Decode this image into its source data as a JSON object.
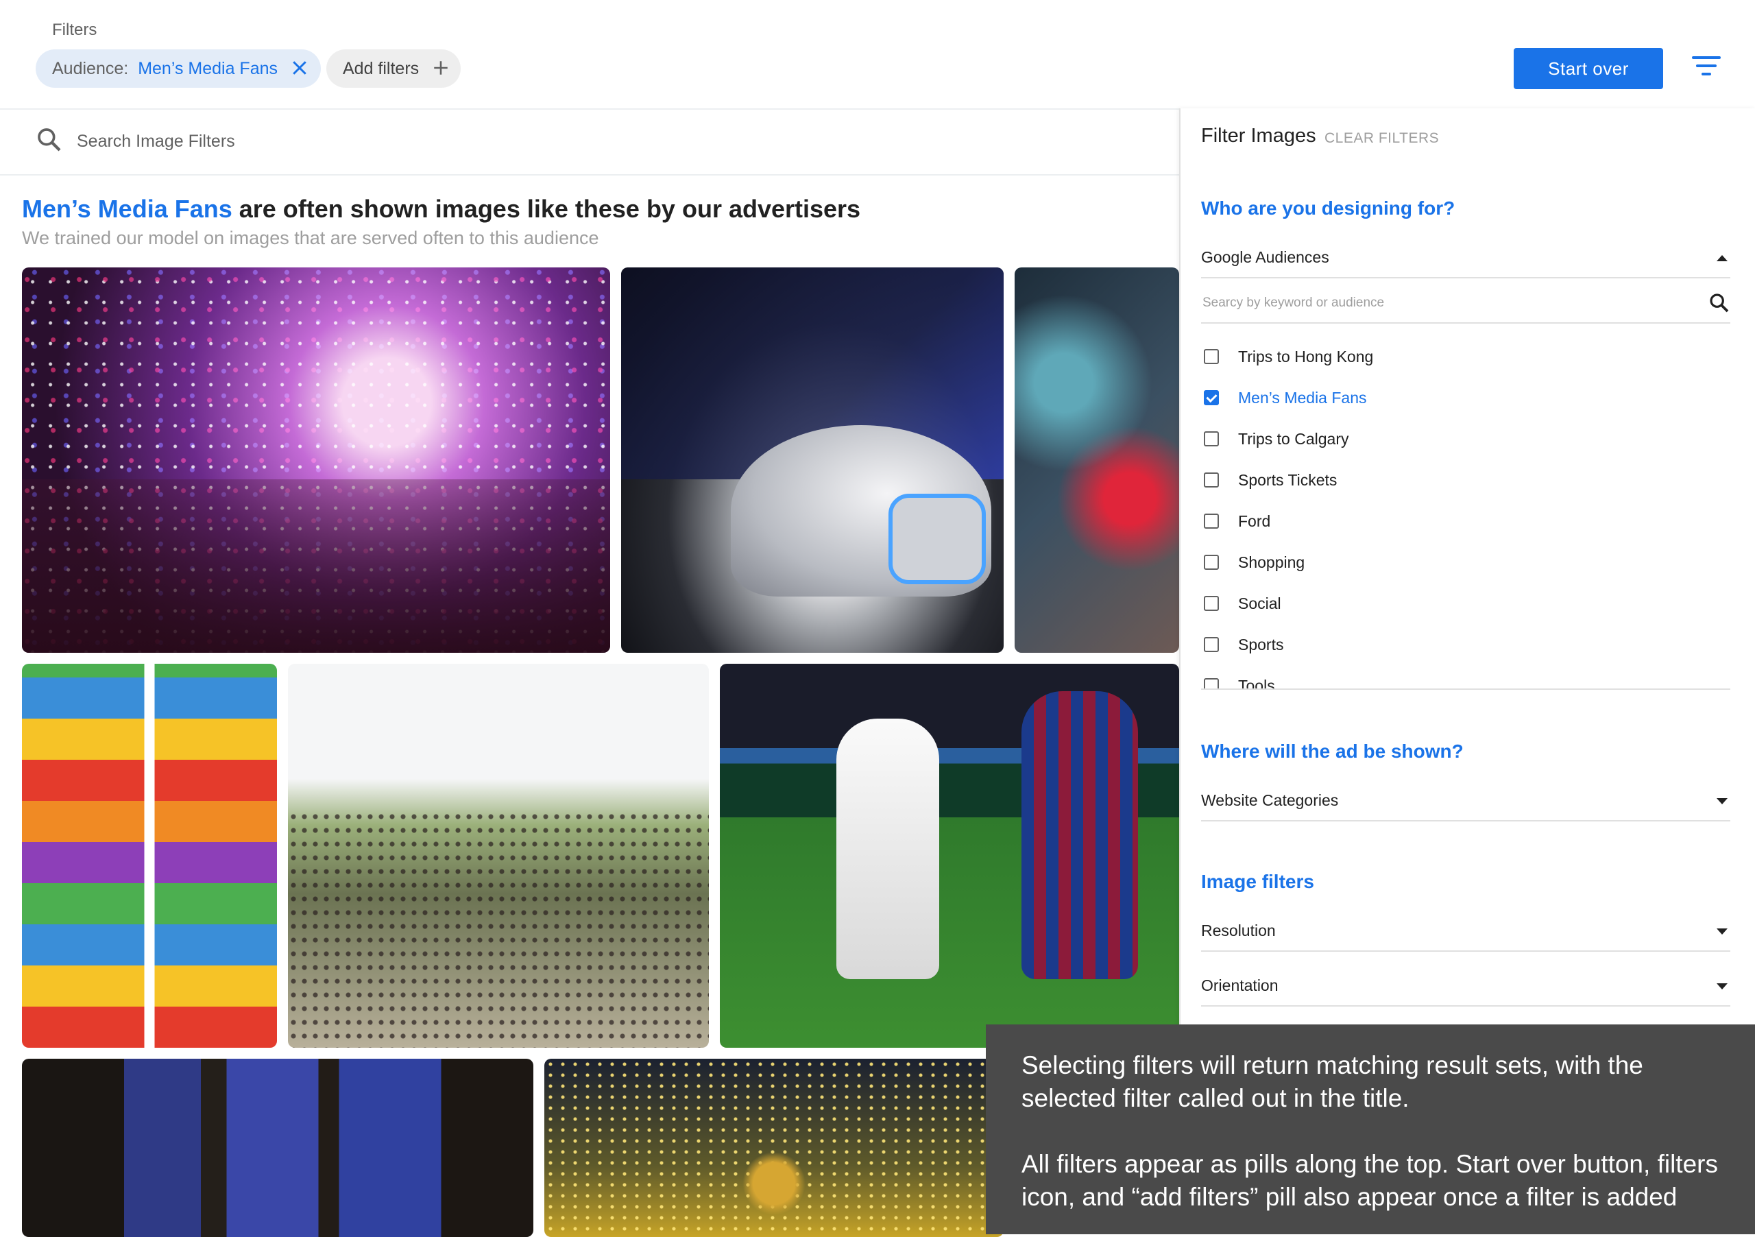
{
  "topbar": {
    "filters_label": "Filters",
    "audience_pill": {
      "key": "Audience:",
      "value": "Men’s Media Fans"
    },
    "add_filters_label": "Add filters",
    "start_over_label": "Start over"
  },
  "search": {
    "placeholder": "Search Image Filters",
    "value": ""
  },
  "results": {
    "title_highlight": "Men’s Media Fans",
    "title_rest": " are often shown images like these by our advertisers",
    "subtitle": "We trained our model on images that are served often to this audience",
    "images": [
      "confetti-crowd",
      "concept-car",
      "blurred-closeup",
      "comic-collage",
      "festival-crowd",
      "soccer-match",
      "esports-gaming",
      "trophy-celebration"
    ]
  },
  "panel": {
    "title": "Filter Images",
    "clear_label": "CLEAR FILTERS",
    "section_who": "Who are you designing for?",
    "audiences_dropdown": "Google Audiences",
    "audience_search_placeholder": "Searcy by keyword or audience",
    "audience_options": [
      {
        "label": "Trips to Hong Kong",
        "checked": false
      },
      {
        "label": "Men’s Media Fans",
        "checked": true
      },
      {
        "label": "Trips to Calgary",
        "checked": false
      },
      {
        "label": "Sports Tickets",
        "checked": false
      },
      {
        "label": "Ford",
        "checked": false
      },
      {
        "label": "Shopping",
        "checked": false
      },
      {
        "label": "Social",
        "checked": false
      },
      {
        "label": "Sports",
        "checked": false
      },
      {
        "label": "Tools",
        "checked": false
      }
    ],
    "section_where": "Where will the ad be shown?",
    "website_dropdown": "Website Categories",
    "section_image": "Image filters",
    "resolution_dropdown": "Resolution",
    "orientation_dropdown": "Orientation"
  },
  "annotation": {
    "p1": "Selecting filters will return matching result sets, with the selected filter called out in the title.",
    "p2": "All filters appear as pills along the top. Start over button, filters icon, and “add filters” pill also appear once a filter is added"
  },
  "colors": {
    "accent": "#1a73e8",
    "pill_bg": "#e3ecf8",
    "annotation_bg": "#4a4a4a"
  }
}
